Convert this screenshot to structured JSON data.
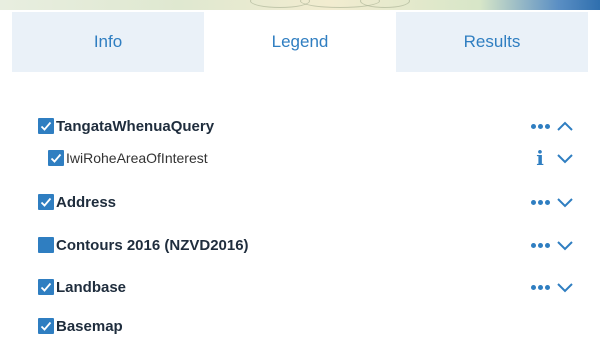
{
  "tabs": [
    {
      "label": "Info",
      "active": false
    },
    {
      "label": "Legend",
      "active": true
    },
    {
      "label": "Results",
      "active": false
    }
  ],
  "layers": [
    {
      "name": "TangataWhenuaQuery",
      "checked": true,
      "expanded": true,
      "has_menu": true
    },
    {
      "name": "IwiRoheAreaOfInterest",
      "checked": true,
      "expanded": false,
      "has_info": true
    },
    {
      "name": "Address",
      "checked": true,
      "expanded": false,
      "has_menu": true
    },
    {
      "name": "Contours 2016 (NZVD2016)",
      "checked": false,
      "expanded": false,
      "has_menu": true
    },
    {
      "name": "Landbase",
      "checked": true,
      "expanded": false,
      "has_menu": true
    },
    {
      "name": "Basemap",
      "checked": true
    }
  ],
  "icons": {
    "checkbox": "check-icon",
    "menu": "more-dots-icon",
    "expand": "chevron-down-icon",
    "collapse": "chevron-up-icon",
    "info": "info-icon"
  },
  "colors": {
    "accent": "#2f7ec1",
    "tab_inactive_bg": "#eaf1f8",
    "text": "#1f2d3d"
  }
}
